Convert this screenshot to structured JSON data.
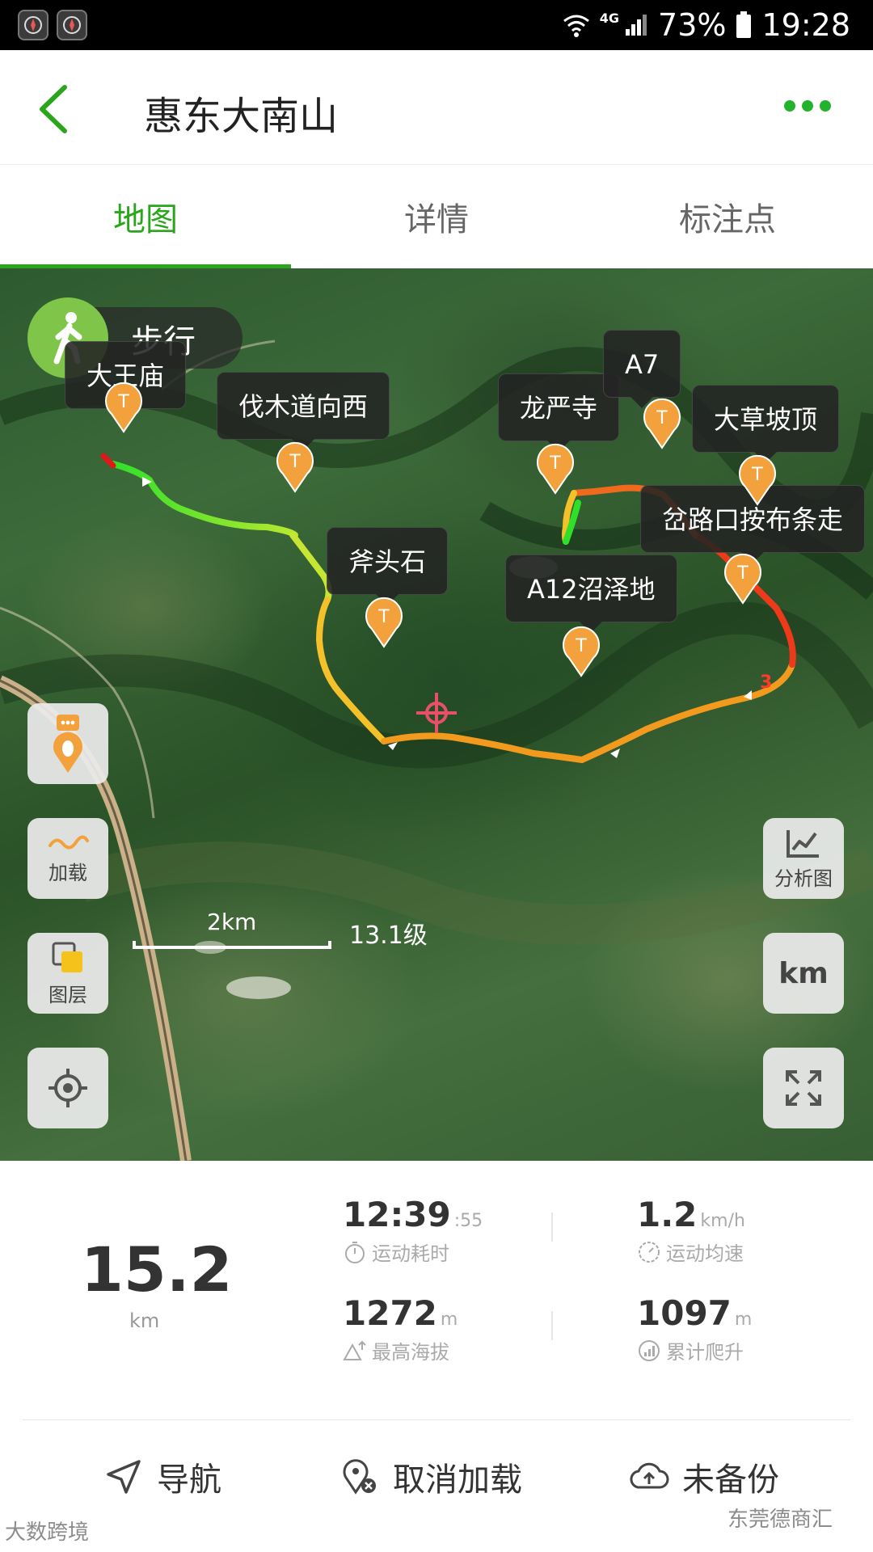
{
  "status_bar": {
    "network": "4G",
    "battery": "73%",
    "time": "19:28"
  },
  "header": {
    "title": "惠东大南山"
  },
  "tabs": [
    {
      "label": "地图",
      "active": true
    },
    {
      "label": "详情",
      "active": false
    },
    {
      "label": "标注点",
      "active": false
    }
  ],
  "map": {
    "mode": "步行",
    "waypoints": [
      "大王庙",
      "伐木道向西",
      "斧头石",
      "A12沼泽地",
      "龙严寺",
      "A7",
      "大草坡顶",
      "岔路口按布条走"
    ],
    "pin_letter": "T",
    "segment_number": "3",
    "controls": {
      "load": "加载",
      "layers": "图层",
      "analysis": "分析图",
      "units": "km"
    },
    "scale_label": "2km",
    "zoom_level": "13.1级"
  },
  "stats": {
    "distance": {
      "value": "15.2",
      "unit": "km"
    },
    "duration": {
      "value": "12:39",
      "seconds": ":55",
      "label": "运动耗时"
    },
    "avg_speed": {
      "value": "1.2",
      "unit": "km/h",
      "label": "运动均速"
    },
    "max_altitude": {
      "value": "1272",
      "unit": "m",
      "label": "最高海拔"
    },
    "total_climb": {
      "value": "1097",
      "unit": "m",
      "label": "累计爬升"
    }
  },
  "actions": {
    "navigate": "导航",
    "unload": "取消加载",
    "backup": "未备份"
  },
  "watermarks": {
    "left": "大数跨境",
    "right": "东莞德商汇"
  },
  "colors": {
    "accent": "#2ba51c",
    "track_start": "#3fdc2a",
    "track_mid": "#f0a020",
    "track_end": "#e01818"
  }
}
